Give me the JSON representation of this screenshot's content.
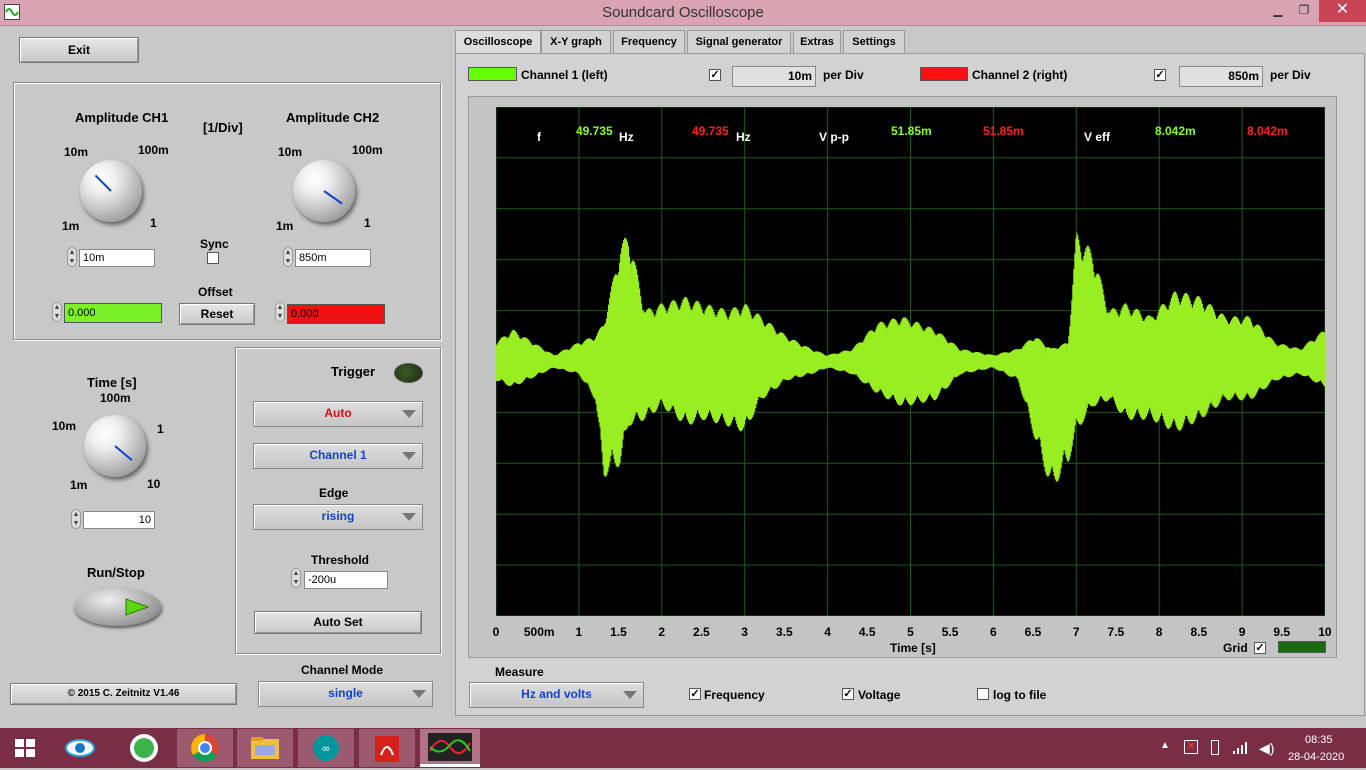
{
  "window": {
    "title": "Soundcard Oscilloscope",
    "minimize": "▁",
    "restore": "❐",
    "close": "✕"
  },
  "left": {
    "exit": "Exit",
    "amp_ch1": {
      "label": "Amplitude CH1",
      "lab_10m": "10m",
      "lab_100m": "100m",
      "lab_1m": "1m",
      "lab_1": "1",
      "value": "10m"
    },
    "amp_ch2": {
      "label": "Amplitude CH2",
      "lab_10m": "10m",
      "lab_100m": "100m",
      "lab_1m": "1m",
      "lab_1": "1",
      "value": "850m"
    },
    "div_label": "[1/Div]",
    "sync": "Sync",
    "offset": {
      "label": "Offset",
      "reset": "Reset",
      "ch1": "0.000",
      "ch2": "0.000"
    },
    "time": {
      "label": "Time [s]",
      "lab_10m": "10m",
      "lab_100m": "100m",
      "lab_1": "1",
      "lab_1m": "1m",
      "lab_10": "10",
      "value": "10"
    },
    "runstop": "Run/Stop",
    "copyright": "© 2015  C. Zeitnitz V1.46",
    "channel_mode": {
      "label": "Channel Mode",
      "value": "single"
    }
  },
  "trigger": {
    "label": "Trigger",
    "mode": "Auto",
    "channel": "Channel 1",
    "edge_label": "Edge",
    "edge": "rising",
    "threshold_label": "Threshold",
    "threshold": "-200u",
    "autoset": "Auto Set"
  },
  "tabs": [
    "Oscilloscope",
    "X-Y graph",
    "Frequency",
    "Signal generator",
    "Extras",
    "Settings"
  ],
  "scope": {
    "ch1_label": "Channel 1 (left)",
    "ch1_div": "10m",
    "ch2_label": "Channel 2 (right)",
    "ch2_div": "850m",
    "per_div": "per Div",
    "ch1_color": "#66ff00",
    "ch2_color": "#ff2020"
  },
  "measurements": {
    "f": "f",
    "f1": "49.735",
    "hz1": "Hz",
    "f2": "49.735",
    "hz2": "Hz",
    "vpp": "V p-p",
    "vpp1": "51.85m",
    "vpp2": "51.85m",
    "veff": "V eff",
    "veff1": "8.042m",
    "veff2": "8.042m"
  },
  "chart_data": {
    "type": "line",
    "xlabel": "Time [s]",
    "x_ticks": [
      "0",
      "500m",
      "1",
      "1.5",
      "2",
      "2.5",
      "3",
      "3.5",
      "4",
      "4.5",
      "5",
      "5.5",
      "6",
      "6.5",
      "7",
      "7.5",
      "8",
      "8.5",
      "9",
      "9.5",
      "10"
    ],
    "xlim": [
      0,
      10
    ],
    "series": [
      {
        "color": "#99ee22",
        "envelope_t": [
          0,
          0.2,
          0.7,
          1.0,
          1.2,
          1.3,
          1.5,
          1.6,
          1.8,
          2.0,
          2.3,
          2.5,
          2.8,
          3.0,
          3.2,
          3.5,
          3.8,
          4.0,
          4.3,
          4.6,
          4.9,
          5.3,
          5.6,
          6.0,
          6.3,
          6.5,
          6.7,
          6.9,
          7.0,
          7.2,
          7.4,
          7.6,
          7.9,
          8.2,
          8.5,
          8.8,
          9.1,
          9.4,
          9.7,
          10.0
        ],
        "envelope_top": [
          0.15,
          0.25,
          0.05,
          0.15,
          0.2,
          0.3,
          0.9,
          1.0,
          0.4,
          0.45,
          0.5,
          0.45,
          0.4,
          0.45,
          0.35,
          0.2,
          0.1,
          0.05,
          0.1,
          0.3,
          0.35,
          0.25,
          0.1,
          0.05,
          0.1,
          0.2,
          0.1,
          0.15,
          1.0,
          0.85,
          0.4,
          0.45,
          0.35,
          0.55,
          0.5,
          0.35,
          0.35,
          0.15,
          0.1,
          0.25
        ],
        "envelope_bottom": [
          0.15,
          0.2,
          0.05,
          0.1,
          0.3,
          0.9,
          0.8,
          0.5,
          0.45,
          0.35,
          0.5,
          0.45,
          0.5,
          0.55,
          0.3,
          0.15,
          0.1,
          0.05,
          0.1,
          0.25,
          0.35,
          0.3,
          0.1,
          0.05,
          0.15,
          0.6,
          1.0,
          0.8,
          0.55,
          0.35,
          0.3,
          0.45,
          0.45,
          0.55,
          0.45,
          0.3,
          0.3,
          0.15,
          0.1,
          0.2
        ]
      }
    ]
  },
  "bottom": {
    "measure_label": "Measure",
    "measure_value": "Hz and volts",
    "grid": "Grid",
    "frequency": "Frequency",
    "voltage": "Voltage",
    "log": "log to file"
  },
  "taskbar": {
    "time": "08:35",
    "date": "28-04-2020"
  }
}
